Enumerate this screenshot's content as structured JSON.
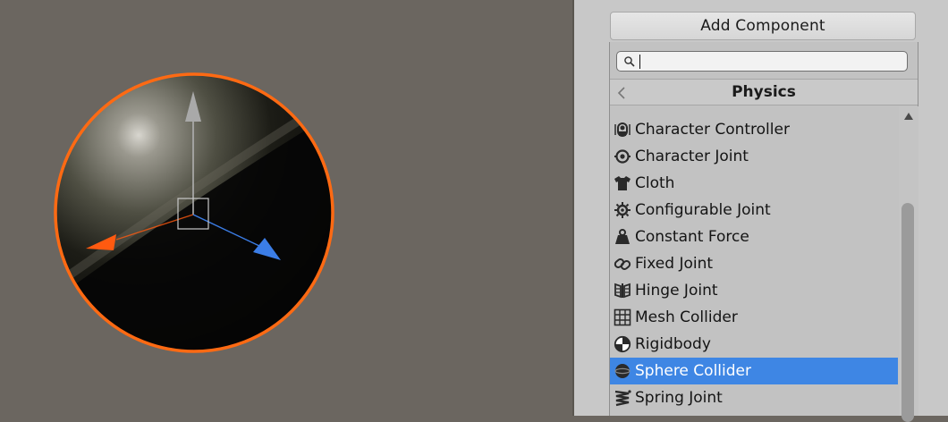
{
  "inspector": {
    "add_component_label": "Add Component",
    "search": {
      "value": "",
      "placeholder": ""
    },
    "category_title": "Physics",
    "items": [
      {
        "label": "Character Controller",
        "icon": "character-controller-icon"
      },
      {
        "label": "Character Joint",
        "icon": "character-joint-icon"
      },
      {
        "label": "Cloth",
        "icon": "cloth-icon"
      },
      {
        "label": "Configurable Joint",
        "icon": "configurable-joint-icon"
      },
      {
        "label": "Constant Force",
        "icon": "constant-force-icon"
      },
      {
        "label": "Fixed Joint",
        "icon": "fixed-joint-icon"
      },
      {
        "label": "Hinge Joint",
        "icon": "hinge-joint-icon"
      },
      {
        "label": "Mesh Collider",
        "icon": "mesh-collider-icon"
      },
      {
        "label": "Rigidbody",
        "icon": "rigidbody-icon"
      },
      {
        "label": "Sphere Collider",
        "icon": "sphere-collider-icon",
        "selected": true
      },
      {
        "label": "Spring Joint",
        "icon": "spring-joint-icon"
      }
    ]
  },
  "colors": {
    "scene_background": "#6b6660",
    "selection_outline": "#ff6a13",
    "gizmo_x": "#ff5a10",
    "gizmo_y": "#b0b0b0",
    "gizmo_z": "#3b7de6",
    "selected_row": "#3e86e4"
  }
}
